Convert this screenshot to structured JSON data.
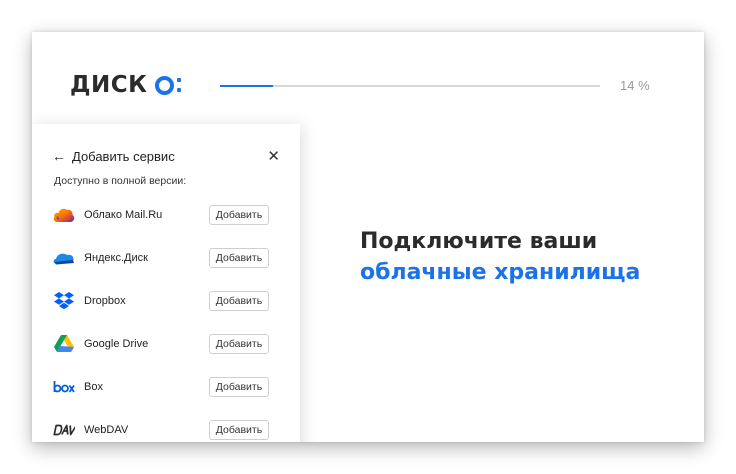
{
  "app": {
    "logo_text": "ДИСК",
    "accent_color": "#1a73e8"
  },
  "progress": {
    "value_percent": 14,
    "label": "14 %"
  },
  "panel": {
    "title": "Добавить сервис",
    "subtitle": "Доступно в полной версии:",
    "services": [
      {
        "name": "Облако Mail.Ru",
        "icon": "mailru-cloud-icon",
        "button": "Добавить"
      },
      {
        "name": "Яндекс.Диск",
        "icon": "yandex-disk-icon",
        "button": "Добавить"
      },
      {
        "name": "Dropbox",
        "icon": "dropbox-icon",
        "button": "Добавить"
      },
      {
        "name": "Google Drive",
        "icon": "google-drive-icon",
        "button": "Добавить"
      },
      {
        "name": "Box",
        "icon": "box-icon",
        "button": "Добавить"
      },
      {
        "name": "WebDAV",
        "icon": "webdav-icon",
        "button": "Добавить"
      }
    ]
  },
  "headline": {
    "line1": "Подключите ваши",
    "line2": "облачные хранилища"
  }
}
